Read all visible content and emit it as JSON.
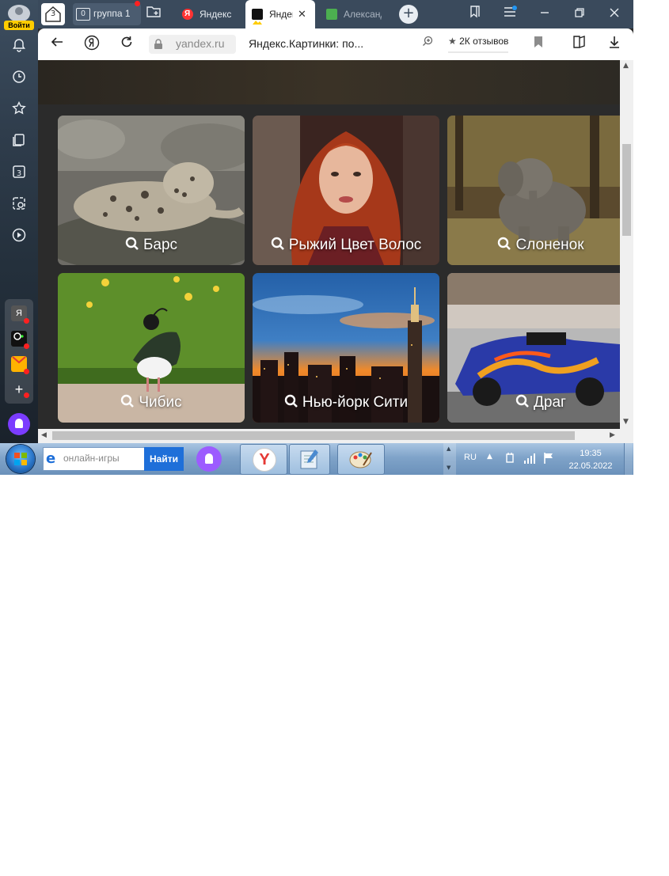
{
  "side_panel": {
    "login_label": "Войти",
    "tabs_count": "3",
    "ext_yandex": "Я"
  },
  "tabs": {
    "home_count": "3",
    "group_count": "0",
    "group_label": "группа 1",
    "items": [
      {
        "title": "Яндекс",
        "favicon_color": "#f33"
      },
      {
        "title": "Яндекс",
        "favicon_color": "#ffcc00",
        "active": true
      },
      {
        "title": "Александ",
        "favicon_color": "#4caf50"
      }
    ]
  },
  "address_bar": {
    "domain": "yandex.ru",
    "page_title": "Яндекс.Картинки: по...",
    "reviews": "2К отзывов"
  },
  "cards": [
    {
      "label": "Барс",
      "image": "snow leopard lying on rocks"
    },
    {
      "label": "Рыжий Цвет Волос",
      "image": "red-haired woman"
    },
    {
      "label": "Слоненок",
      "image": "baby elephant"
    },
    {
      "label": "Чибис",
      "image": "lapwing bird in grass"
    },
    {
      "label": "Нью-йорк Сити",
      "image": "New York skyline at sunset"
    },
    {
      "label": "Драг",
      "image": "drag racing car"
    }
  ],
  "taskbar": {
    "search_placeholder": "онлайн-игры",
    "search_button": "Найти",
    "lang": "RU",
    "time": "19:35",
    "date": "22.05.2022"
  }
}
